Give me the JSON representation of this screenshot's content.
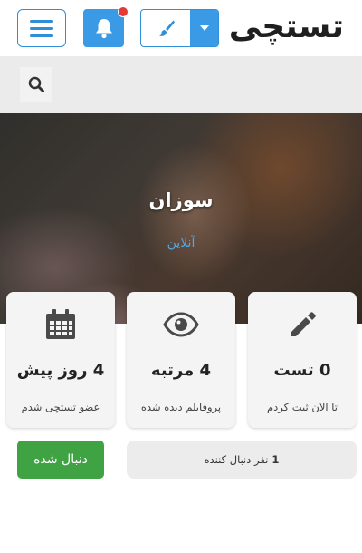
{
  "header": {
    "logo_text": "تستچی",
    "menu_icon": "hamburger-icon",
    "notification_icon": "bell-icon",
    "theme_icon": "paint-brush-icon",
    "dropdown_icon": "caret-down-icon",
    "accent_color": "#3a9ae6",
    "badge_color": "#e53935"
  },
  "search": {
    "icon": "search-icon"
  },
  "profile": {
    "name": "سوزان",
    "status": "آنلاین",
    "status_color": "#4fa8ea"
  },
  "stats": [
    {
      "icon": "pencil-icon",
      "value": "0 تست",
      "label": "تا الان ثبت کردم"
    },
    {
      "icon": "eye-icon",
      "value": "4 مرتبه",
      "label": "پروفایلم دیده شده"
    },
    {
      "icon": "calendar-icon",
      "value": "4 روز پیش",
      "label": "عضو تستچی شدم"
    }
  ],
  "followers": {
    "count": "1",
    "text": "نفر دنبال کننده"
  },
  "follow_button": {
    "label": "دنبال شده",
    "color": "#3fa343"
  }
}
